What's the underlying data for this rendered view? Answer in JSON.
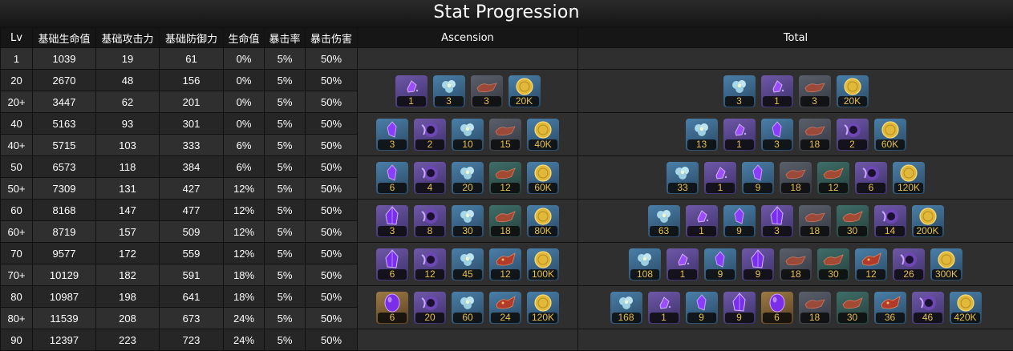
{
  "title": "Stat Progression",
  "headers": [
    "Lv",
    "基础生命值",
    "基础攻击力",
    "基础防御力",
    "生命值",
    "暴击率",
    "暴击伤害",
    "Ascension",
    "Total"
  ],
  "rows": [
    [
      "1",
      "1039",
      "19",
      "61",
      "0%",
      "5%",
      "50%"
    ],
    [
      "20",
      "2670",
      "48",
      "156",
      "0%",
      "5%",
      "50%"
    ],
    [
      "20+",
      "3447",
      "62",
      "201",
      "0%",
      "5%",
      "50%"
    ],
    [
      "40",
      "5163",
      "93",
      "301",
      "0%",
      "5%",
      "50%"
    ],
    [
      "40+",
      "5715",
      "103",
      "333",
      "6%",
      "5%",
      "50%"
    ],
    [
      "50",
      "6573",
      "118",
      "384",
      "6%",
      "5%",
      "50%"
    ],
    [
      "50+",
      "7309",
      "131",
      "427",
      "12%",
      "5%",
      "50%"
    ],
    [
      "60",
      "8168",
      "147",
      "477",
      "12%",
      "5%",
      "50%"
    ],
    [
      "60+",
      "8719",
      "157",
      "509",
      "12%",
      "5%",
      "50%"
    ],
    [
      "70",
      "9577",
      "172",
      "559",
      "12%",
      "5%",
      "50%"
    ],
    [
      "70+",
      "10129",
      "182",
      "591",
      "18%",
      "5%",
      "50%"
    ],
    [
      "80",
      "10987",
      "198",
      "641",
      "18%",
      "5%",
      "50%"
    ],
    [
      "80+",
      "11539",
      "208",
      "673",
      "24%",
      "5%",
      "50%"
    ],
    [
      "90",
      "12397",
      "223",
      "723",
      "24%",
      "5%",
      "50%"
    ]
  ],
  "ascension": [
    [
      {
        "icon": "gem-sliver-icon",
        "count": "1",
        "rarity": "purple"
      },
      {
        "icon": "blue-flower-icon",
        "count": "3",
        "rarity": "blue"
      },
      {
        "icon": "mob-drop-icon",
        "count": "3",
        "rarity": "gray"
      },
      {
        "icon": "mora-coin-icon",
        "count": "20K",
        "rarity": "blue"
      }
    ],
    [
      {
        "icon": "gem-fragment-icon",
        "count": "3",
        "rarity": "blue"
      },
      {
        "icon": "boss-material-icon",
        "count": "2",
        "rarity": "purple"
      },
      {
        "icon": "blue-flower-icon",
        "count": "10",
        "rarity": "blue"
      },
      {
        "icon": "mob-drop-icon",
        "count": "15",
        "rarity": "gray"
      },
      {
        "icon": "mora-coin-icon",
        "count": "40K",
        "rarity": "blue"
      }
    ],
    [
      {
        "icon": "gem-fragment-icon",
        "count": "6",
        "rarity": "blue"
      },
      {
        "icon": "boss-material-icon",
        "count": "4",
        "rarity": "purple"
      },
      {
        "icon": "blue-flower-icon",
        "count": "20",
        "rarity": "blue"
      },
      {
        "icon": "mob-drop-green-icon",
        "count": "12",
        "rarity": "green"
      },
      {
        "icon": "mora-coin-icon",
        "count": "60K",
        "rarity": "blue"
      }
    ],
    [
      {
        "icon": "gem-chunk-icon",
        "count": "3",
        "rarity": "purple"
      },
      {
        "icon": "boss-material-icon",
        "count": "8",
        "rarity": "purple"
      },
      {
        "icon": "blue-flower-icon",
        "count": "30",
        "rarity": "blue"
      },
      {
        "icon": "mob-drop-green-icon",
        "count": "18",
        "rarity": "green"
      },
      {
        "icon": "mora-coin-icon",
        "count": "80K",
        "rarity": "blue"
      }
    ],
    [
      {
        "icon": "gem-chunk-icon",
        "count": "6",
        "rarity": "purple"
      },
      {
        "icon": "boss-material-icon",
        "count": "12",
        "rarity": "purple"
      },
      {
        "icon": "blue-flower-icon",
        "count": "45",
        "rarity": "blue"
      },
      {
        "icon": "mob-drop-blue-icon",
        "count": "12",
        "rarity": "blue"
      },
      {
        "icon": "mora-coin-icon",
        "count": "100K",
        "rarity": "blue"
      }
    ],
    [
      {
        "icon": "gem-gemstone-icon",
        "count": "6",
        "rarity": "gold"
      },
      {
        "icon": "boss-material-icon",
        "count": "20",
        "rarity": "purple"
      },
      {
        "icon": "blue-flower-icon",
        "count": "60",
        "rarity": "blue"
      },
      {
        "icon": "mob-drop-blue-icon",
        "count": "24",
        "rarity": "blue"
      },
      {
        "icon": "mora-coin-icon",
        "count": "120K",
        "rarity": "blue"
      }
    ]
  ],
  "totals": [
    [
      {
        "icon": "blue-flower-icon",
        "count": "3",
        "rarity": "blue"
      },
      {
        "icon": "gem-sliver-icon",
        "count": "1",
        "rarity": "purple"
      },
      {
        "icon": "mob-drop-icon",
        "count": "3",
        "rarity": "gray"
      },
      {
        "icon": "mora-coin-icon",
        "count": "20K",
        "rarity": "blue"
      }
    ],
    [
      {
        "icon": "blue-flower-icon",
        "count": "13",
        "rarity": "blue"
      },
      {
        "icon": "gem-sliver-icon",
        "count": "1",
        "rarity": "purple"
      },
      {
        "icon": "gem-fragment-icon",
        "count": "3",
        "rarity": "blue"
      },
      {
        "icon": "mob-drop-icon",
        "count": "18",
        "rarity": "gray"
      },
      {
        "icon": "boss-material-icon",
        "count": "2",
        "rarity": "purple"
      },
      {
        "icon": "mora-coin-icon",
        "count": "60K",
        "rarity": "blue"
      }
    ],
    [
      {
        "icon": "blue-flower-icon",
        "count": "33",
        "rarity": "blue"
      },
      {
        "icon": "gem-sliver-icon",
        "count": "1",
        "rarity": "purple"
      },
      {
        "icon": "gem-fragment-icon",
        "count": "9",
        "rarity": "blue"
      },
      {
        "icon": "mob-drop-icon",
        "count": "18",
        "rarity": "gray"
      },
      {
        "icon": "mob-drop-green-icon",
        "count": "12",
        "rarity": "green"
      },
      {
        "icon": "boss-material-icon",
        "count": "6",
        "rarity": "purple"
      },
      {
        "icon": "mora-coin-icon",
        "count": "120K",
        "rarity": "blue"
      }
    ],
    [
      {
        "icon": "blue-flower-icon",
        "count": "63",
        "rarity": "blue"
      },
      {
        "icon": "gem-sliver-icon",
        "count": "1",
        "rarity": "purple"
      },
      {
        "icon": "gem-fragment-icon",
        "count": "9",
        "rarity": "blue"
      },
      {
        "icon": "gem-chunk-icon",
        "count": "3",
        "rarity": "purple"
      },
      {
        "icon": "mob-drop-icon",
        "count": "18",
        "rarity": "gray"
      },
      {
        "icon": "mob-drop-green-icon",
        "count": "30",
        "rarity": "green"
      },
      {
        "icon": "boss-material-icon",
        "count": "14",
        "rarity": "purple"
      },
      {
        "icon": "mora-coin-icon",
        "count": "200K",
        "rarity": "blue"
      }
    ],
    [
      {
        "icon": "blue-flower-icon",
        "count": "108",
        "rarity": "blue"
      },
      {
        "icon": "gem-sliver-icon",
        "count": "1",
        "rarity": "purple"
      },
      {
        "icon": "gem-fragment-icon",
        "count": "9",
        "rarity": "blue"
      },
      {
        "icon": "gem-chunk-icon",
        "count": "9",
        "rarity": "purple"
      },
      {
        "icon": "mob-drop-icon",
        "count": "18",
        "rarity": "gray"
      },
      {
        "icon": "mob-drop-green-icon",
        "count": "30",
        "rarity": "green"
      },
      {
        "icon": "mob-drop-blue-icon",
        "count": "12",
        "rarity": "blue"
      },
      {
        "icon": "boss-material-icon",
        "count": "26",
        "rarity": "purple"
      },
      {
        "icon": "mora-coin-icon",
        "count": "300K",
        "rarity": "blue"
      }
    ],
    [
      {
        "icon": "blue-flower-icon",
        "count": "168",
        "rarity": "blue"
      },
      {
        "icon": "gem-sliver-icon",
        "count": "1",
        "rarity": "purple"
      },
      {
        "icon": "gem-fragment-icon",
        "count": "9",
        "rarity": "blue"
      },
      {
        "icon": "gem-chunk-icon",
        "count": "9",
        "rarity": "purple"
      },
      {
        "icon": "gem-gemstone-icon",
        "count": "6",
        "rarity": "gold"
      },
      {
        "icon": "mob-drop-icon",
        "count": "18",
        "rarity": "gray"
      },
      {
        "icon": "mob-drop-green-icon",
        "count": "30",
        "rarity": "green"
      },
      {
        "icon": "mob-drop-blue-icon",
        "count": "36",
        "rarity": "blue"
      },
      {
        "icon": "boss-material-icon",
        "count": "46",
        "rarity": "purple"
      },
      {
        "icon": "mora-coin-icon",
        "count": "420K",
        "rarity": "blue"
      }
    ]
  ]
}
